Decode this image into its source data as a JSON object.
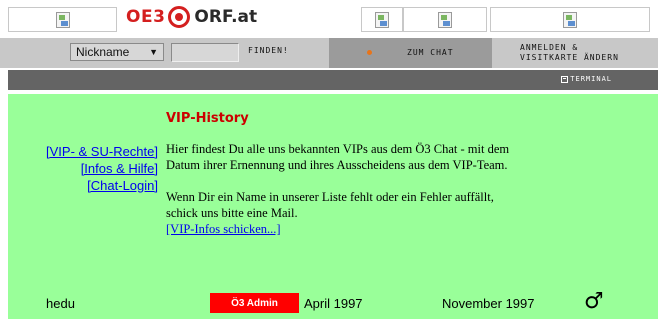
{
  "banner": {
    "logo_part1": "OE3",
    "logo_part2": "ORF.at"
  },
  "nav": {
    "nickname_select": "Nickname",
    "find_label": "FINDEN!",
    "chat_label": "ZUM CHAT",
    "login_line1": "ANMELDEN &",
    "login_line2": "VISITKARTE ÄNDERN"
  },
  "terminal": {
    "label": "TERMINAL"
  },
  "content": {
    "heading": "VIP-History",
    "side_links": [
      "[VIP- & SU-Rechte]",
      "[Infos & Hilfe]",
      "[Chat-Login]"
    ],
    "paragraph1": "Hier findest Du alle uns bekannten VIPs aus dem Ö3 Chat - mit dem Datum ihrer Ernennung und ihres Ausscheidens aus dem VIP-Team.",
    "paragraph2": "Wenn Dir ein Name in unserer Liste fehlt oder ein Fehler auffällt, schick uns bitte eine Mail.",
    "mail_link": "[VIP-Infos schicken...]"
  },
  "vip_row": {
    "name": "hedu",
    "role": "Ö3 Admin",
    "start": "April 1997",
    "end": "November 1997",
    "gender_icon": "male-symbol-icon",
    "role_color": "#ff0000"
  },
  "colors": {
    "content_bg": "#99ff99",
    "heading": "#cc0000",
    "nav_bg": "#c8c8c8",
    "chat_bg": "#9b9b9b",
    "terminal_bg": "#646464",
    "link": "#0000ee"
  }
}
